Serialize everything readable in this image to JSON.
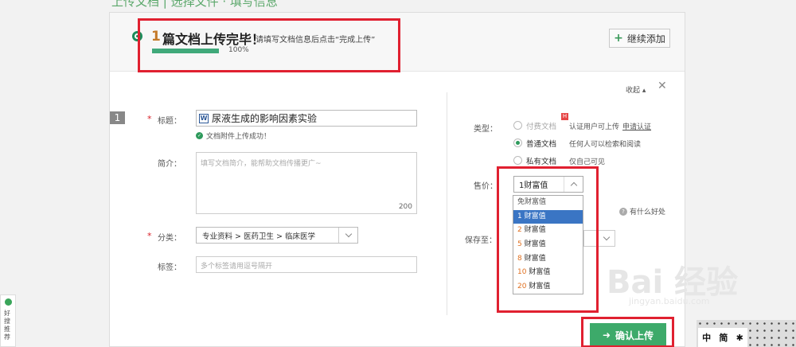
{
  "page_header": {
    "text": "上传文档 | 选择文件 · 填写信息"
  },
  "status": {
    "count": "1",
    "title": "篇文档上传完毕！",
    "hint": "请填写文档信息后点击“完成上传”",
    "progress_percent": 100,
    "progress_label": "100%",
    "add_more_label": "继续添加"
  },
  "panel": {
    "collapse_label": "收起 ▴",
    "close_glyph": "✕"
  },
  "form": {
    "index": "1",
    "title_label": "标题：",
    "title_value": "尿液生成的影响因素实验",
    "title_icon": "W",
    "upload_ok_text": "文档附件上传成功！",
    "summary_label": "简介：",
    "summary_placeholder": "填写文档简介，能帮助文档传播更广~",
    "summary_count": "200",
    "category_label": "分类：",
    "category_value": "专业资料 > 医药卫生 > 临床医学",
    "tags_label": "标签：",
    "tags_placeholder": "多个标签请用逗号隔开"
  },
  "type_section": {
    "label": "类型：",
    "options": [
      {
        "label": "付费文档",
        "desc": "认证用户可上传",
        "link": "申请认证",
        "badge": "H",
        "checked": false
      },
      {
        "label": "普通文档",
        "desc": "任何人可以检索和阅读",
        "checked": true
      },
      {
        "label": "私有文档",
        "desc": "仅自己可见",
        "checked": false
      }
    ]
  },
  "price": {
    "label": "售价：",
    "selected": "1财富值",
    "options": [
      {
        "num": "",
        "text": "免财富值"
      },
      {
        "num": "1",
        "text": " 财富值"
      },
      {
        "num": "2",
        "text": " 财富值"
      },
      {
        "num": "5",
        "text": " 财富值"
      },
      {
        "num": "8",
        "text": " 财富值"
      },
      {
        "num": "10",
        "text": " 财富值"
      },
      {
        "num": "20",
        "text": " 财富值"
      }
    ],
    "help_text": "有什么好处"
  },
  "save": {
    "label": "保存至："
  },
  "confirm": {
    "label": "确认上传",
    "arrow": "➜"
  },
  "side_tab": {
    "text": "好搜推荐"
  },
  "ime": {
    "items": [
      "中",
      "简",
      "✱"
    ]
  },
  "watermark": {
    "main": "Bai 经验",
    "sub": "jingyan.baidu.com"
  },
  "colors": {
    "accent_green": "#3daa6a",
    "annotation_red": "#e02030",
    "dropdown_selected": "#3a75c4",
    "price_num": "#e07020"
  }
}
